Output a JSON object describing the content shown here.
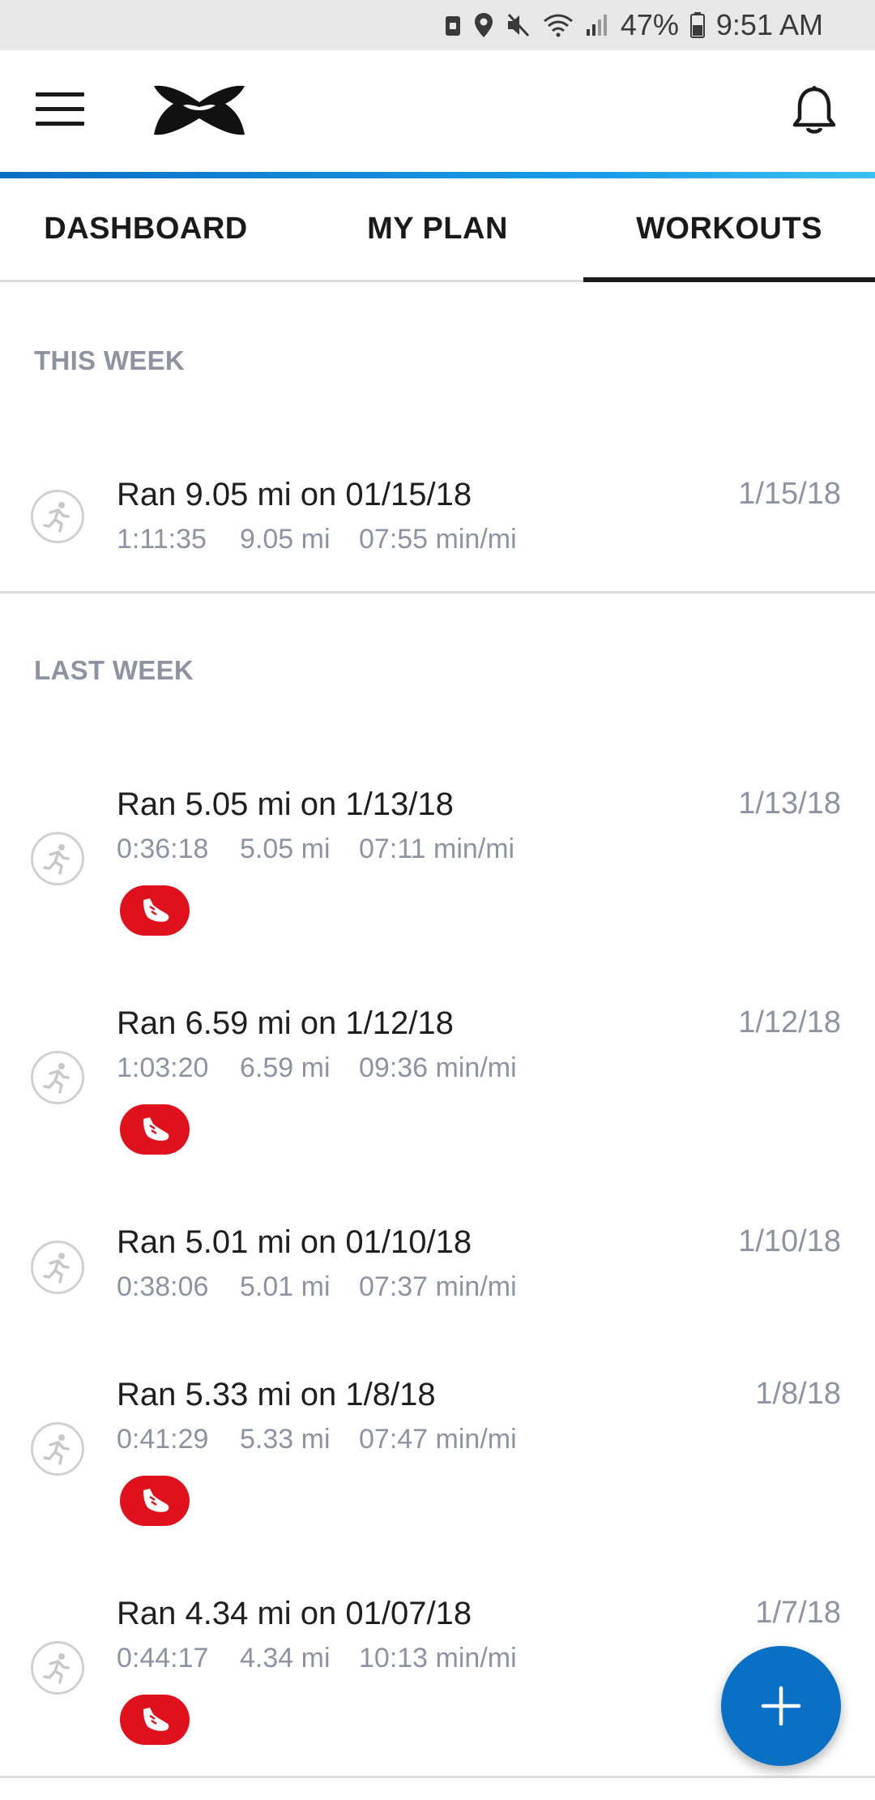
{
  "status_bar": {
    "battery": "47%",
    "time": "9:51 AM"
  },
  "app_bar": {
    "menu_icon": "hamburger-menu-icon",
    "logo": "under-armour-logo",
    "notification_icon": "bell-icon"
  },
  "colors": {
    "accent_blue": "#0a70c6",
    "badge_red": "#e0101c",
    "muted_text": "#8d93a0"
  },
  "tabs": [
    {
      "label": "DASHBOARD",
      "active": false
    },
    {
      "label": "MY PLAN",
      "active": false
    },
    {
      "label": "WORKOUTS",
      "active": true
    }
  ],
  "sections": [
    {
      "label": "THIS WEEK",
      "workouts": [
        {
          "title": "Ran 9.05 mi on 01/15/18",
          "date": "1/15/18",
          "duration": "1:11:35",
          "distance": "9.05 mi",
          "pace": "07:55 min/mi",
          "shoe_badge": false
        }
      ]
    },
    {
      "label": "LAST WEEK",
      "workouts": [
        {
          "title": "Ran 5.05 mi on 1/13/18",
          "date": "1/13/18",
          "duration": "0:36:18",
          "distance": "5.05 mi",
          "pace": "07:11 min/mi",
          "shoe_badge": true
        },
        {
          "title": "Ran 6.59 mi on 1/12/18",
          "date": "1/12/18",
          "duration": "1:03:20",
          "distance": "6.59 mi",
          "pace": "09:36 min/mi",
          "shoe_badge": true
        },
        {
          "title": "Ran 5.01 mi on 01/10/18",
          "date": "1/10/18",
          "duration": "0:38:06",
          "distance": "5.01 mi",
          "pace": "07:37 min/mi",
          "shoe_badge": false
        },
        {
          "title": "Ran 5.33 mi on 1/8/18",
          "date": "1/8/18",
          "duration": "0:41:29",
          "distance": "5.33 mi",
          "pace": "07:47 min/mi",
          "shoe_badge": true
        },
        {
          "title": "Ran 4.34 mi on 01/07/18",
          "date": "1/7/18",
          "duration": "0:44:17",
          "distance": "4.34 mi",
          "pace": "10:13 min/mi",
          "shoe_badge": true
        }
      ]
    }
  ],
  "fab": {
    "icon": "plus-icon"
  }
}
